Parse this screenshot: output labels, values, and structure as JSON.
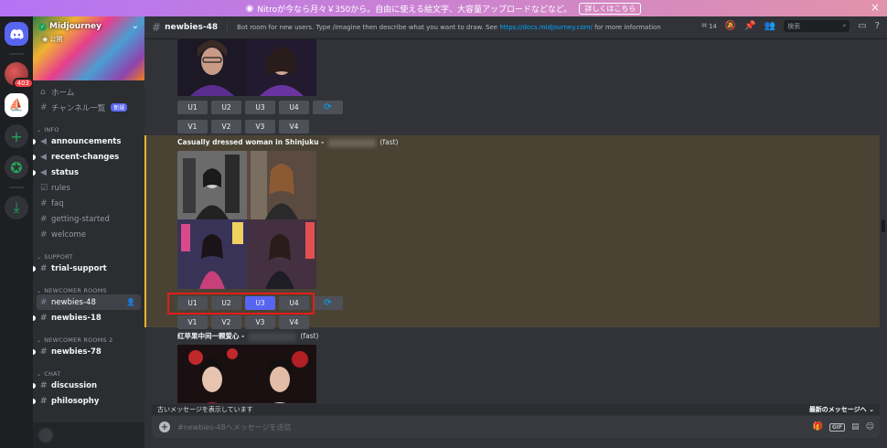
{
  "banner": {
    "text": "Nitroが今なら月々￥350から。自由に使える絵文字、大容量アップロードなどなど。",
    "button": "詳しくはこちら",
    "close": "×"
  },
  "rail": {
    "badge": "403"
  },
  "guild": {
    "name": "Midjourney",
    "visibility": "公開"
  },
  "sidebar": {
    "home": "ホーム",
    "channel_list": "チャンネル一覧",
    "new_tag": "新規",
    "categories": {
      "info": "INFO",
      "support": "SUPPORT",
      "newcomer": "NEWCOMER ROOMS",
      "newcomer2": "NEWCOMER ROOMS 2",
      "chat": "CHAT"
    },
    "info_channels": [
      "announcements",
      "recent-changes",
      "status",
      "rules",
      "faq",
      "getting-started",
      "welcome"
    ],
    "support_channels": [
      "trial-support"
    ],
    "newcomer_channels": [
      "newbies-48",
      "newbies-18"
    ],
    "newcomer2_channels": [
      "newbies-78"
    ],
    "chat_channels": [
      "discussion",
      "philosophy"
    ]
  },
  "header": {
    "channel": "newbies-48",
    "topic_pre": "Bot room for new users. Type /imagine then describe what you want to draw. See ",
    "topic_link": "https://docs.midjourney.com/",
    "topic_post": " for more information",
    "thread_count": "14",
    "search_placeholder": "検索"
  },
  "messages": [
    {
      "buttons_u": [
        "U1",
        "U2",
        "U3",
        "U4"
      ],
      "buttons_v": [
        "V1",
        "V2",
        "V3",
        "V4"
      ]
    },
    {
      "prompt": "Casually dressed woman in Shinjuku",
      "sep": "-",
      "speed": "(fast)",
      "buttons_u": [
        "U1",
        "U2",
        "U3",
        "U4"
      ],
      "buttons_v": [
        "V1",
        "V2",
        "V3",
        "V4"
      ],
      "selected": "U3"
    },
    {
      "prompt": "红苹果中间一颗爱心",
      "sep": "-",
      "speed": "(fast)"
    }
  ],
  "bottom": {
    "old_messages": "古いメッセージを表示しています",
    "jump": "最新のメッセージへ",
    "placeholder": "#newbies-48へメッセージを送信",
    "gif": "GIF"
  },
  "colors": {
    "accent": "#5865f2",
    "highlight_bg": "#4a4334",
    "highlight_border": "#f0b232",
    "callout": "#e11d1d",
    "link": "#00a8fc"
  },
  "icons": [
    "nitro-icon",
    "discord-icon",
    "compass-icon",
    "download-icon",
    "add-server-icon",
    "hash-icon",
    "threads-icon",
    "mute-icon",
    "pin-icon",
    "members-icon",
    "search-icon",
    "inbox-icon",
    "help-icon",
    "reroll-icon",
    "gift-icon",
    "sticker-icon",
    "emoji-icon"
  ]
}
